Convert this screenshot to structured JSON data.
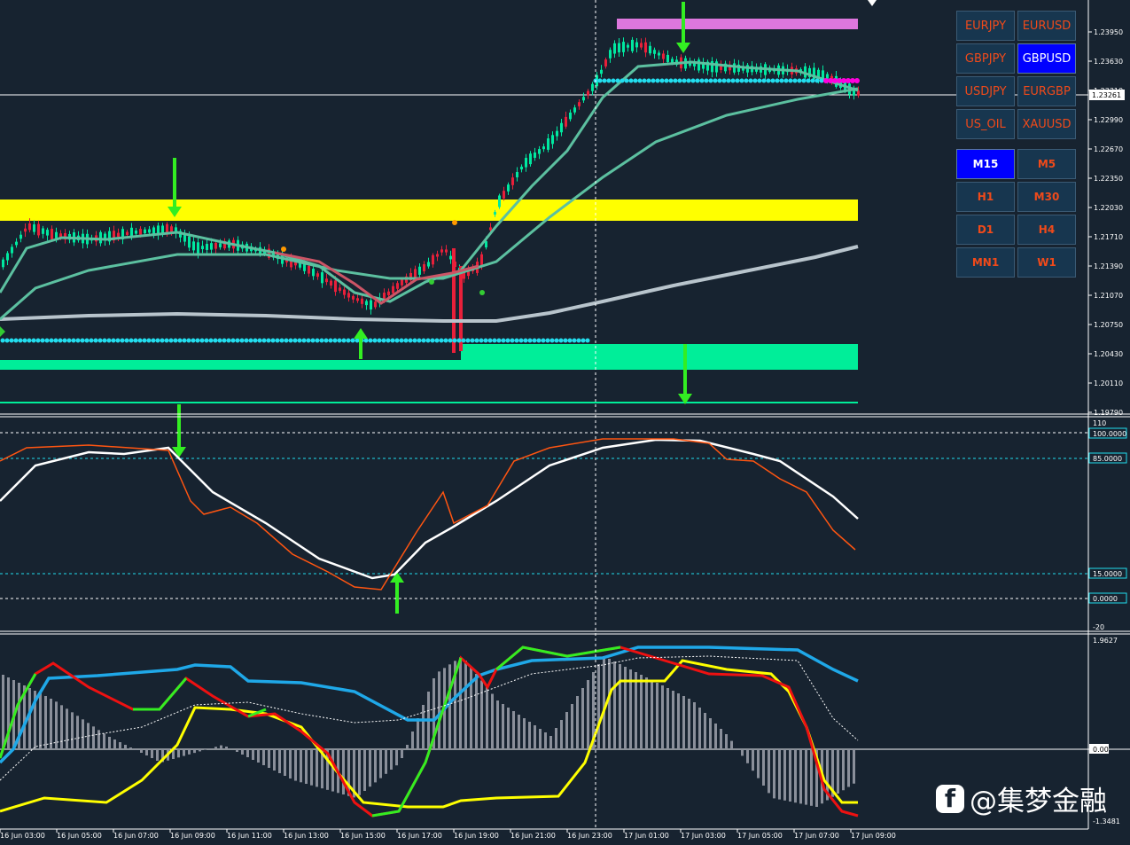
{
  "symbols": [
    {
      "label": "EURJPY",
      "active": false
    },
    {
      "label": "EURUSD",
      "active": false
    },
    {
      "label": "GBPJPY",
      "active": false
    },
    {
      "label": "GBPUSD",
      "active": true
    },
    {
      "label": "USDJPY",
      "active": false
    },
    {
      "label": "EURGBP",
      "active": false
    },
    {
      "label": "US_OIL",
      "active": false
    },
    {
      "label": "XAUUSD",
      "active": false
    }
  ],
  "timeframes": [
    {
      "label": "M15",
      "active": true
    },
    {
      "label": "M5",
      "active": false
    },
    {
      "label": "H1",
      "active": false
    },
    {
      "label": "M30",
      "active": false
    },
    {
      "label": "D1",
      "active": false
    },
    {
      "label": "H4",
      "active": false
    },
    {
      "label": "MN1",
      "active": false
    },
    {
      "label": "W1",
      "active": false
    }
  ],
  "price_axis": [
    "1.23950",
    "1.23630",
    "1.23310",
    "1.22990",
    "1.22670",
    "1.22350",
    "1.22030",
    "1.21710",
    "1.21390",
    "1.21070",
    "1.20750",
    "1.20430",
    "1.20110",
    "1.19790"
  ],
  "current_price": "1.23261",
  "stoch_axis": [
    "110",
    "100.0000",
    "85.0000",
    "15.0000",
    "0.0000",
    "-20"
  ],
  "macd_axis": [
    "1.9627",
    "0.00",
    "-1.3481"
  ],
  "time_axis": [
    "16 Jun 03:00",
    "16 Jun 05:00",
    "16 Jun 07:00",
    "16 Jun 09:00",
    "16 Jun 11:00",
    "16 Jun 13:00",
    "16 Jun 15:00",
    "16 Jun 17:00",
    "16 Jun 19:00",
    "16 Jun 21:00",
    "16 Jun 23:00",
    "17 Jun 01:00",
    "17 Jun 03:00",
    "17 Jun 05:00",
    "17 Jun 07:00",
    "17 Jun 09:00"
  ],
  "watermark": {
    "icon": "facebook-icon",
    "text": "@集梦金融"
  },
  "colors": {
    "background": "#172330",
    "grid_text": "#ffffff",
    "resistance_zone": "#ffff00",
    "support_zone": "#00ee99",
    "top_zone": "#dd77dd",
    "bull_candle": "#00e8a0",
    "bear_candle": "#e8203a",
    "signal_arrow": "#33ee22",
    "dots": "#22ddee",
    "stoch_main": "#ffffff",
    "stoch_signal": "#ff5511",
    "macd_blue": "#1fa8e8",
    "macd_yellow": "#ffff00",
    "macd_red": "#ee1111",
    "macd_green": "#33ee22",
    "button_active": "#0000ff",
    "button_text": "#f04a1a"
  }
}
